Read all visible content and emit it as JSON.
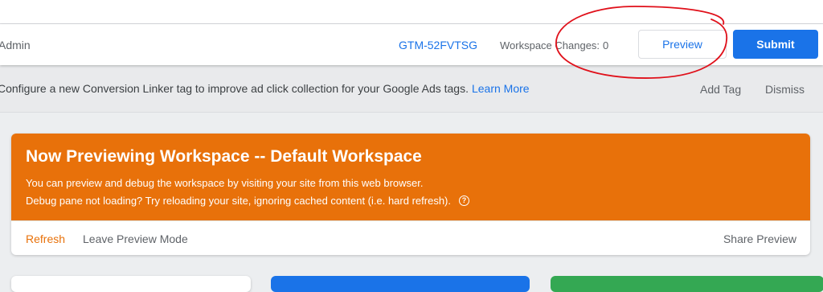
{
  "header": {
    "admin_label": "Admin",
    "container_id": "GTM-52FVTSG",
    "workspace_changes_label": "Workspace Changes:",
    "workspace_changes_count": "0",
    "preview_label": "Preview",
    "submit_label": "Submit"
  },
  "banner": {
    "message": "Configure a new Conversion Linker tag to improve ad click collection for your Google Ads tags.",
    "learn_more": "Learn More",
    "add_tag": "Add Tag",
    "dismiss": "Dismiss"
  },
  "preview_card": {
    "title": "Now Previewing Workspace -- Default Workspace",
    "line1": "You can preview and debug the workspace by visiting your site from this web browser.",
    "line2": "Debug pane not loading? Try reloading your site, ignoring cached content (i.e. hard refresh).",
    "help_icon": "question-circle-icon",
    "refresh": "Refresh",
    "leave_preview": "Leave Preview Mode",
    "share_preview": "Share Preview"
  },
  "colors": {
    "accent_blue": "#1a73e8",
    "preview_orange": "#e8710a",
    "tile_green": "#34a853",
    "annotation_red": "#e0101a"
  }
}
